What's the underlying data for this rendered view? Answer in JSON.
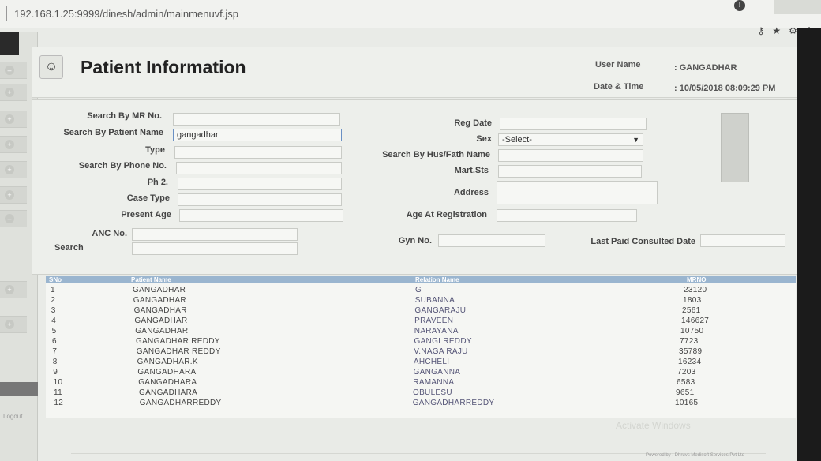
{
  "browser": {
    "url": "192.168.1.25:9999/dinesh/admin/mainmenuvf.jsp"
  },
  "header": {
    "title": "Patient Information",
    "user_name_label": "User Name",
    "user_name_value": ": GANGADHAR",
    "date_time_label": "Date & Time",
    "date_time_value": ": 10/05/2018   08:09:29 PM"
  },
  "form": {
    "mr_no_label": "Search By MR No.",
    "patient_name_label": "Search By Patient Name",
    "patient_name_value": "gangadhar",
    "type_label": "Type",
    "phone_label": "Search By Phone No.",
    "ph2_label": "Ph 2.",
    "case_type_label": "Case Type",
    "present_age_label": "Present Age",
    "anc_label": "ANC No.",
    "search_label": "Search",
    "reg_date_label": "Reg Date",
    "sex_label": "Sex",
    "sex_value": "-Select-",
    "hus_fath_label": "Search By Hus/Fath Name",
    "mart_label": "Mart.Sts",
    "address_label": "Address",
    "age_reg_label": "Age At Registration",
    "gyn_label": "Gyn No.",
    "last_paid_label": "Last Paid Consulted Date"
  },
  "grid": {
    "columns": [
      "SNo",
      "Patient Name",
      "Relation Name",
      "MRNO"
    ],
    "rows": [
      [
        "1",
        "GANGADHAR",
        "G",
        "23120"
      ],
      [
        "2",
        "GANGADHAR",
        "SUBANNA",
        "1803"
      ],
      [
        "3",
        "GANGADHAR",
        "GANGARAJU",
        "2561"
      ],
      [
        "4",
        "GANGADHAR",
        "PRAVEEN",
        "146627"
      ],
      [
        "5",
        "GANGADHAR",
        "NARAYANA",
        "10750"
      ],
      [
        "6",
        "GANGADHAR REDDY",
        "GANGI REDDY",
        "7723"
      ],
      [
        "7",
        "GANGADHAR REDDY",
        "V.NAGA RAJU",
        "35789"
      ],
      [
        "8",
        "GANGADHAR.K",
        "AHCHELI",
        "16234"
      ],
      [
        "9",
        "GANGADHARA",
        "GANGANNA",
        "7203"
      ],
      [
        "10",
        "GANGADHARA",
        "RAMANNA",
        "6583"
      ],
      [
        "11",
        "GANGADHARA",
        "OBULESU",
        "9651"
      ],
      [
        "12",
        "GANGADHARREDDY",
        "GANGADHARREDDY",
        "10165"
      ]
    ]
  },
  "sidebar": {
    "logout_label": "Logout"
  },
  "footer": {
    "powered_by": "Powered by : Dhruvs Medisoft Services Pvt Ltd",
    "activate": "Activate Windows"
  }
}
